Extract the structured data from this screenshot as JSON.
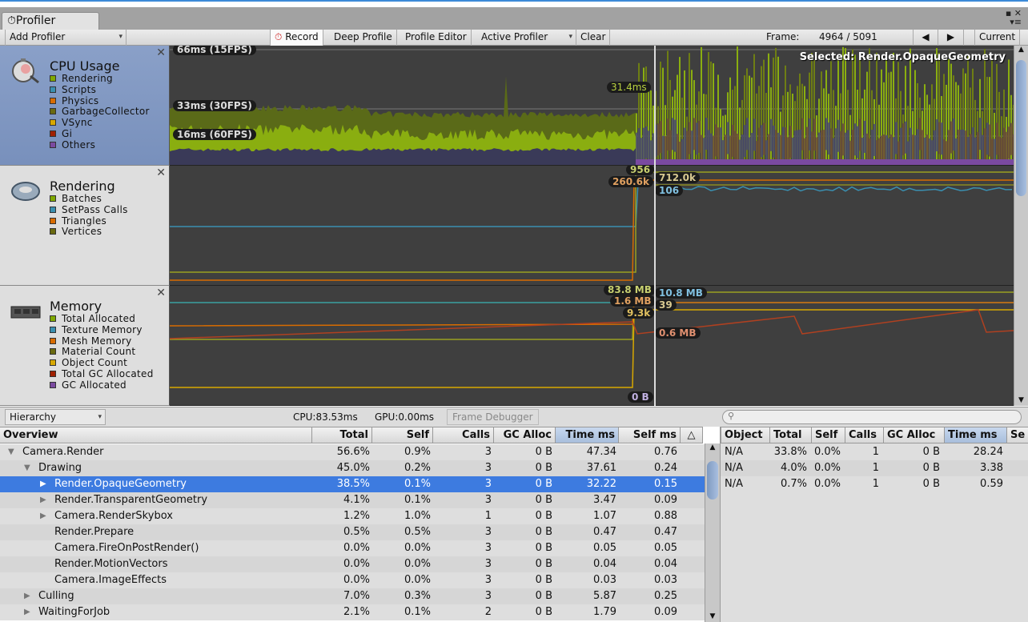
{
  "window": {
    "tab_title": "Profiler"
  },
  "toolbar": {
    "add_profiler": "Add Profiler",
    "record": "Record",
    "deep_profile": "Deep Profile",
    "profile_editor": "Profile Editor",
    "active_profiler": "Active Profiler",
    "clear": "Clear",
    "frame_label": "Frame:",
    "frame_value": "4964 / 5091",
    "prev": "◀",
    "next": "▶",
    "current": "Current"
  },
  "modules": [
    {
      "title": "CPU Usage",
      "items": [
        {
          "label": "Rendering",
          "color": "#7fa800"
        },
        {
          "label": "Scripts",
          "color": "#3a8fb0"
        },
        {
          "label": "Physics",
          "color": "#d86c00"
        },
        {
          "label": "GarbageCollector",
          "color": "#6a6a10"
        },
        {
          "label": "VSync",
          "color": "#d8a800"
        },
        {
          "label": "Gi",
          "color": "#a02000"
        },
        {
          "label": "Others",
          "color": "#7a4aa0"
        }
      ],
      "labels": {
        "ms66": "66ms (15FPS)",
        "ms33": "33ms (30FPS)",
        "ms16": "16ms (60FPS)",
        "selected_value": "31.4ms",
        "selected": "Selected: Render.OpaqueGeometry"
      }
    },
    {
      "title": "Rendering",
      "items": [
        {
          "label": "Batches",
          "color": "#7fa800"
        },
        {
          "label": "SetPass Calls",
          "color": "#3a8fb0"
        },
        {
          "label": "Triangles",
          "color": "#d86c00"
        },
        {
          "label": "Vertices",
          "color": "#6a6a10"
        }
      ],
      "labels": {
        "batches": "956",
        "triangles": "260.6k",
        "vertices": "712.0k",
        "setpass": "106"
      }
    },
    {
      "title": "Memory",
      "items": [
        {
          "label": "Total Allocated",
          "color": "#7fa800"
        },
        {
          "label": "Texture Memory",
          "color": "#3a8fb0"
        },
        {
          "label": "Mesh Memory",
          "color": "#d86c00"
        },
        {
          "label": "Material Count",
          "color": "#6a6a10"
        },
        {
          "label": "Object Count",
          "color": "#d8a800"
        },
        {
          "label": "Total GC Allocated",
          "color": "#a02000"
        },
        {
          "label": "GC Allocated",
          "color": "#7a4aa0"
        }
      ],
      "labels": {
        "total": "83.8 MB",
        "texture": "10.8 MB",
        "mesh": "1.6 MB",
        "material": "39",
        "object": "9.3k",
        "totalgc": "0.6 MB",
        "gc": "0 B"
      }
    }
  ],
  "details": {
    "view": "Hierarchy",
    "cpu": "CPU:83.53ms",
    "gpu": "GPU:0.00ms",
    "frame_debugger": "Frame Debugger",
    "search_placeholder": ""
  },
  "table": {
    "columns": [
      "Overview",
      "Total",
      "Self",
      "Calls",
      "GC Alloc",
      "Time ms",
      "Self ms"
    ],
    "rows": [
      {
        "name": "Camera.Render",
        "indent": 0,
        "arrow": "▼",
        "total": "56.6%",
        "self": "0.9%",
        "calls": "3",
        "gc": "0 B",
        "time": "47.34",
        "selfms": "0.76"
      },
      {
        "name": "Drawing",
        "indent": 1,
        "arrow": "▼",
        "total": "45.0%",
        "self": "0.2%",
        "calls": "3",
        "gc": "0 B",
        "time": "37.61",
        "selfms": "0.24"
      },
      {
        "name": "Render.OpaqueGeometry",
        "indent": 2,
        "arrow": "▶",
        "total": "38.5%",
        "self": "0.1%",
        "calls": "3",
        "gc": "0 B",
        "time": "32.22",
        "selfms": "0.15",
        "selected": true
      },
      {
        "name": "Render.TransparentGeometry",
        "indent": 2,
        "arrow": "▶",
        "total": "4.1%",
        "self": "0.1%",
        "calls": "3",
        "gc": "0 B",
        "time": "3.47",
        "selfms": "0.09"
      },
      {
        "name": "Camera.RenderSkybox",
        "indent": 2,
        "arrow": "▶",
        "total": "1.2%",
        "self": "1.0%",
        "calls": "1",
        "gc": "0 B",
        "time": "1.07",
        "selfms": "0.88"
      },
      {
        "name": "Render.Prepare",
        "indent": 2,
        "arrow": "",
        "total": "0.5%",
        "self": "0.5%",
        "calls": "3",
        "gc": "0 B",
        "time": "0.47",
        "selfms": "0.47"
      },
      {
        "name": "Camera.FireOnPostRender()",
        "indent": 2,
        "arrow": "",
        "total": "0.0%",
        "self": "0.0%",
        "calls": "3",
        "gc": "0 B",
        "time": "0.05",
        "selfms": "0.05"
      },
      {
        "name": "Render.MotionVectors",
        "indent": 2,
        "arrow": "",
        "total": "0.0%",
        "self": "0.0%",
        "calls": "3",
        "gc": "0 B",
        "time": "0.04",
        "selfms": "0.04"
      },
      {
        "name": "Camera.ImageEffects",
        "indent": 2,
        "arrow": "",
        "total": "0.0%",
        "self": "0.0%",
        "calls": "3",
        "gc": "0 B",
        "time": "0.03",
        "selfms": "0.03"
      },
      {
        "name": "Culling",
        "indent": 1,
        "arrow": "▶",
        "total": "7.0%",
        "self": "0.3%",
        "calls": "3",
        "gc": "0 B",
        "time": "5.87",
        "selfms": "0.25"
      },
      {
        "name": "WaitingForJob",
        "indent": 1,
        "arrow": "▶",
        "total": "2.1%",
        "self": "0.1%",
        "calls": "2",
        "gc": "0 B",
        "time": "1.79",
        "selfms": "0.09"
      }
    ]
  },
  "objects": {
    "columns": [
      "Object",
      "Total",
      "Self",
      "Calls",
      "GC Alloc",
      "Time ms",
      "Se"
    ],
    "rows": [
      {
        "object": "N/A",
        "total": "33.8%",
        "self": "0.0%",
        "calls": "1",
        "gc": "0 B",
        "time": "28.24"
      },
      {
        "object": "N/A",
        "total": "4.0%",
        "self": "0.0%",
        "calls": "1",
        "gc": "0 B",
        "time": "3.38"
      },
      {
        "object": "N/A",
        "total": "0.7%",
        "self": "0.0%",
        "calls": "1",
        "gc": "0 B",
        "time": "0.59"
      }
    ]
  }
}
